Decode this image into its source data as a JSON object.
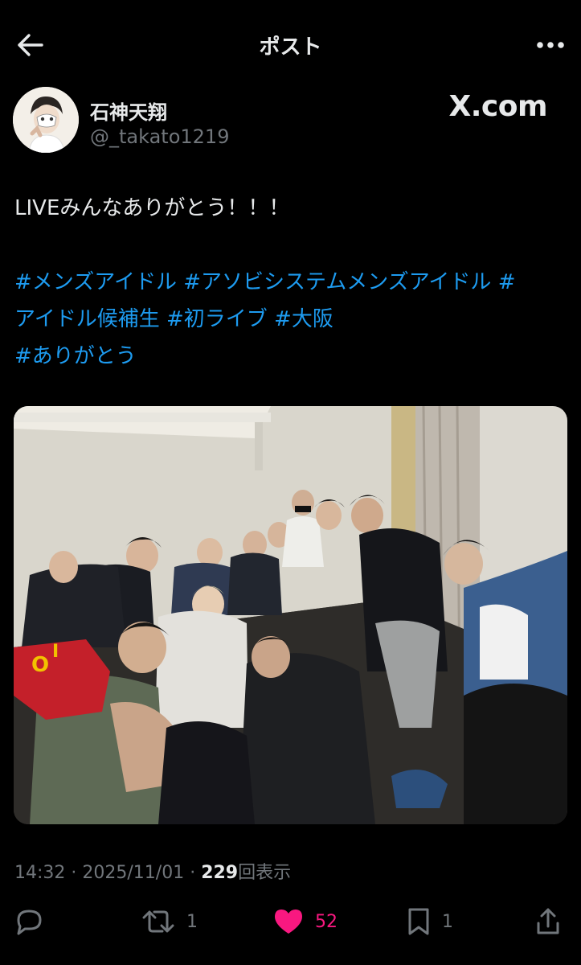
{
  "header": {
    "title": "ポスト",
    "back_icon": "arrow-left-icon",
    "more_icon": "more-dots-icon"
  },
  "author": {
    "name": "石神天翔",
    "handle": "@_takato1219",
    "source_logo": "X.com"
  },
  "post": {
    "text_line1": "LIVEみんなありがとう！！！",
    "hashtags": {
      "h1": "#メンズアイドル",
      "h2": "#アソビシステムメンズアイドル",
      "h3a": "#",
      "h3b": "アイドル候補生",
      "h4": "#初ライブ",
      "h5": "#大阪",
      "h6": "#ありがとう"
    }
  },
  "meta": {
    "time": "14:32",
    "date": "2025/11/01",
    "views": "229",
    "views_label": "回表示"
  },
  "actions": {
    "reply": {
      "icon": "reply-icon",
      "count": ""
    },
    "repost": {
      "icon": "repost-icon",
      "count": "1"
    },
    "like": {
      "icon": "heart-icon",
      "count": "52",
      "color": "#f91880"
    },
    "bookmark": {
      "icon": "bookmark-icon",
      "count": "1"
    },
    "share": {
      "icon": "share-icon",
      "count": ""
    }
  },
  "colors": {
    "background": "#000000",
    "text": "#e7e9ea",
    "muted": "#71767b",
    "link": "#1d9bf0",
    "like": "#f91880"
  }
}
